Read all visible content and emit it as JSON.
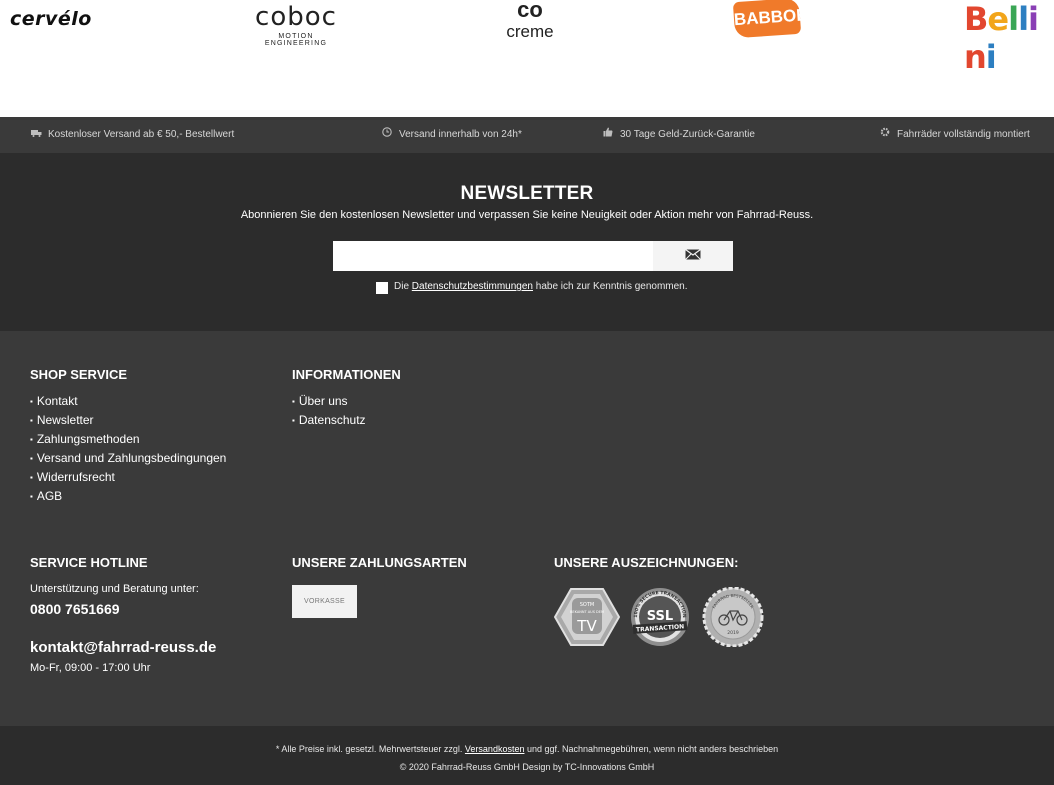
{
  "brands": {
    "cervelo": "cervélo",
    "coboc_main": "coboc",
    "coboc_sub": "MOTION ENGINEERING",
    "creme_mark": "co",
    "creme_name": "creme",
    "babboe": "BABBOE",
    "bellini": "Bellini"
  },
  "usp": {
    "shipping_free": "Kostenloser Versand ab € 50,- Bestellwert",
    "shipping_time": "Versand innerhalb von 24h*",
    "money_back": "30 Tage Geld-Zurück-Garantie",
    "assembled": "Fahrräder vollständig montiert"
  },
  "newsletter": {
    "title": "NEWSLETTER",
    "description": "Abonnieren Sie den kostenlosen Newsletter und verpassen Sie keine Neuigkeit oder Aktion mehr von Fahrrad-Reuss.",
    "email_value": "",
    "submit_icon": "envelope-icon",
    "consent_prefix": "Die",
    "consent_link": "Datenschutzbestimmungen",
    "consent_suffix": "habe ich zur Kenntnis genommen."
  },
  "shop_service": {
    "title": "SHOP SERVICE",
    "links": [
      "Kontakt",
      "Newsletter",
      "Zahlungsmethoden",
      "Versand und Zahlungsbedingungen",
      "Widerrufsrecht",
      "AGB"
    ]
  },
  "informationen": {
    "title": "INFORMATIONEN",
    "links": [
      "Über uns",
      "Datenschutz"
    ]
  },
  "hotline": {
    "title": "SERVICE HOTLINE",
    "label": "Unterstützung und Beratung unter:",
    "phone": "0800 7651669",
    "email": "kontakt@fahrrad-reuss.de",
    "hours": "Mo-Fr, 09:00 - 17:00 Uhr"
  },
  "payments": {
    "title": "UNSERE ZAHLUNGSARTEN",
    "method": "VORKASSE"
  },
  "awards": {
    "title": "UNSERE AUSZEICHNUNGEN:",
    "tv_top": "SOTM",
    "tv_mid": "BEKANNT AUS DEM",
    "tv_big": "TV",
    "ssl_ring": "100% SECURE TRANSACTION",
    "ssl_big": "SSL",
    "ssl_band": "TRANSACTION",
    "best_ring": "FAHRRAD BESTSELLER",
    "best_year": "2019"
  },
  "bottom": {
    "note_prefix": "* Alle Preise inkl. gesetzl. Mehrwertsteuer zzgl.",
    "note_link": "Versandkosten",
    "note_suffix": "und ggf. Nachnahmegebühren, wenn nicht anders beschrieben",
    "copyright": "© 2020 Fahrrad-Reuss GmbH Design by TC-Innovations GmbH"
  },
  "colors": {
    "dark_bg": "#2c2c2c",
    "mid_bg": "#3a3a3a",
    "babboe_orange": "#f07a2a"
  }
}
